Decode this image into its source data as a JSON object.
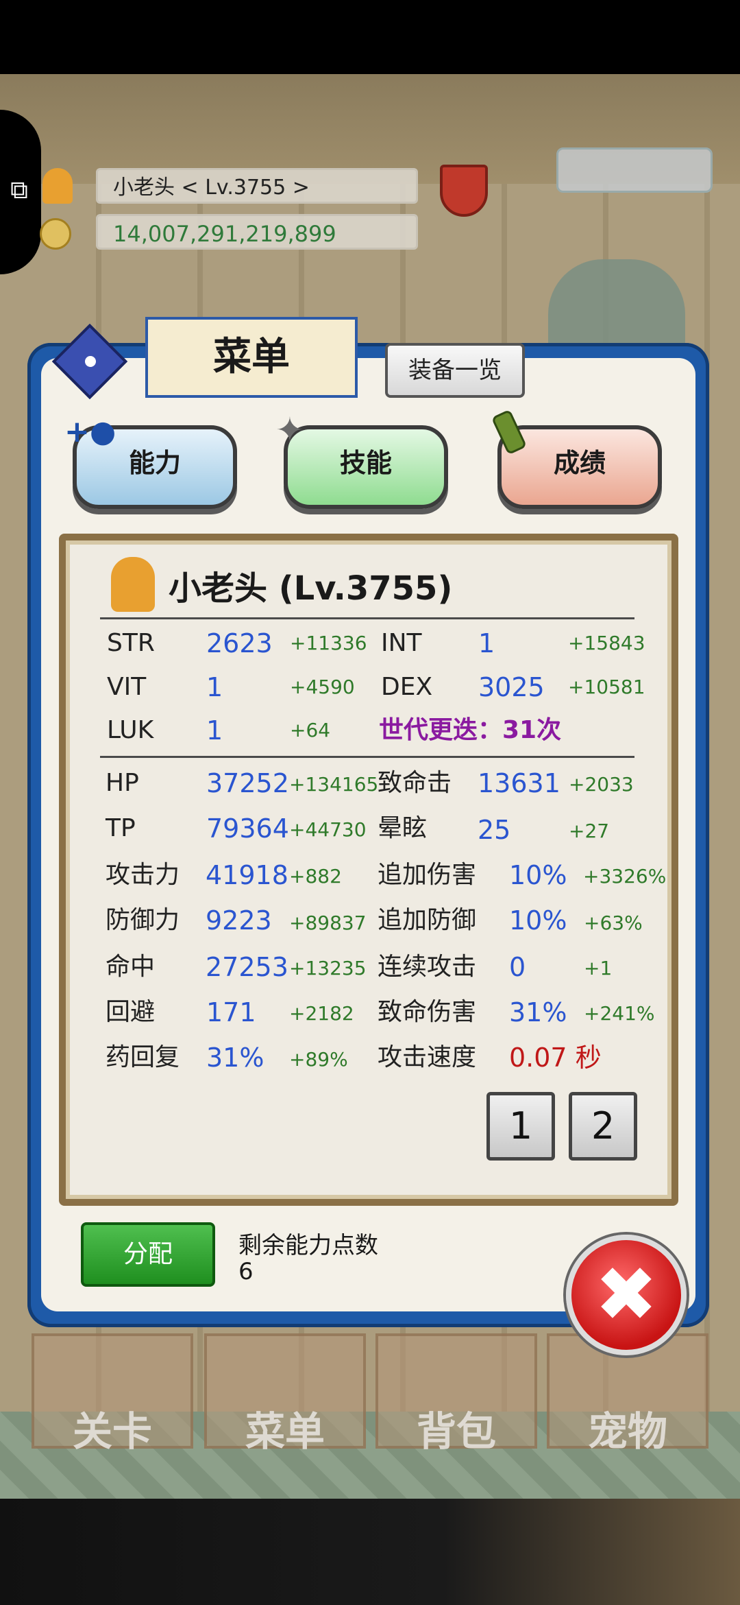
{
  "hud": {
    "player": "小老头    < Lv.3755 >",
    "gold": "14,007,291,219,899"
  },
  "menu": {
    "title": "菜单",
    "equip_list": "装备一览",
    "tabs": [
      "能力",
      "技能",
      "成绩"
    ]
  },
  "character": {
    "name": "小老头 (Lv.3755)"
  },
  "basic_stats": [
    {
      "label": "STR",
      "value": "2623",
      "bonus": "+11336"
    },
    {
      "label": "INT",
      "value": "1",
      "bonus": "+15843"
    },
    {
      "label": "VIT",
      "value": "1",
      "bonus": "+4590"
    },
    {
      "label": "DEX",
      "value": "3025",
      "bonus": "+10581"
    },
    {
      "label": "LUK",
      "value": "1",
      "bonus": "+64"
    }
  ],
  "generation": "世代更迭：31次",
  "combat_stats": [
    {
      "label": "HP",
      "value": "37252",
      "bonus": "+134165"
    },
    {
      "label": "致命击",
      "value": "13631",
      "bonus": "+2033"
    },
    {
      "label": "TP",
      "value": "79364",
      "bonus": "+44730"
    },
    {
      "label": "晕眩",
      "value": "25",
      "bonus": "+27"
    },
    {
      "label": "攻击力",
      "value": "41918",
      "bonus": "+882"
    },
    {
      "label": "追加伤害",
      "value": "10%",
      "bonus": "+3326%"
    },
    {
      "label": "防御力",
      "value": "9223",
      "bonus": "+89837"
    },
    {
      "label": "追加防御",
      "value": "10%",
      "bonus": "+63%"
    },
    {
      "label": "命中",
      "value": "27253",
      "bonus": "+13235"
    },
    {
      "label": "连续攻击",
      "value": "0",
      "bonus": "+1"
    },
    {
      "label": "回避",
      "value": "171",
      "bonus": "+2182"
    },
    {
      "label": "致命伤害",
      "value": "31%",
      "bonus": "+241%"
    },
    {
      "label": "药回复",
      "value": "31%",
      "bonus": "+89%"
    },
    {
      "label": "攻击速度",
      "value": "0.07 秒",
      "bonus": ""
    }
  ],
  "pages": [
    "1",
    "2"
  ],
  "assign_button": "分配",
  "remaining": {
    "label": "剩余能力点数",
    "value": "6"
  },
  "close_glyph": "✖",
  "bottom_nav": [
    "关卡",
    "菜单",
    "背包",
    "宠物"
  ],
  "colors": {
    "panel_border": "#1e5aa8",
    "stat_value": "#2a55d0",
    "bonus": "#2f7a2a",
    "generation": "#8a1aa0",
    "attack_speed": "#c01818",
    "assign_button": "#2a9a2a",
    "close_button": "#d42020"
  },
  "icons": {
    "side_tab": "puzzle-icon",
    "tab_ability": "person-add-icon",
    "tab_skill": "shuriken-icon",
    "tab_record": "scroll-icon",
    "menu": "book-icon"
  }
}
